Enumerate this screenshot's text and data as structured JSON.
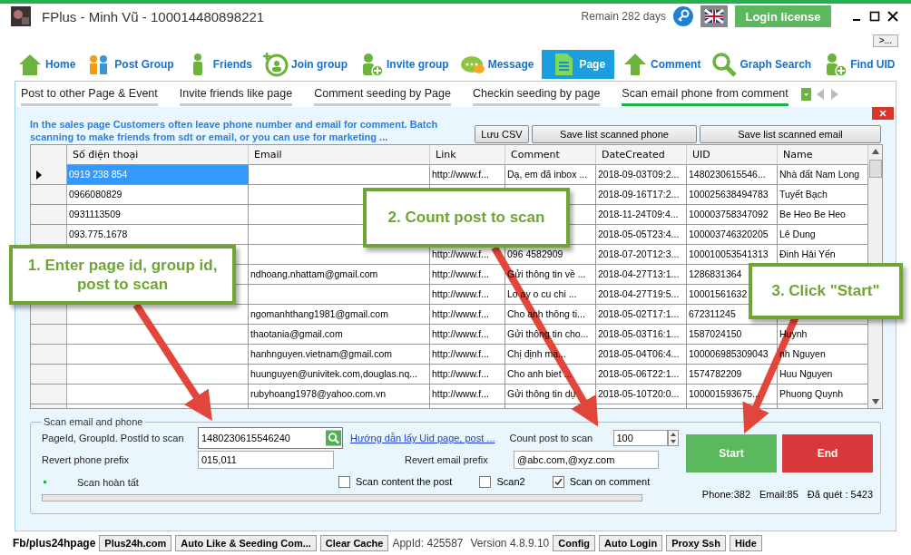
{
  "window": {
    "title": "FPlus - Minh Vũ - 100014480898221",
    "remain": "Remain 282 days",
    "login_button": "Login license",
    "overflow_button": ">..."
  },
  "toolbar": [
    {
      "label": "Home",
      "selected": false
    },
    {
      "label": "Post Group",
      "selected": false
    },
    {
      "label": "Friends",
      "selected": false
    },
    {
      "label": "Join group",
      "selected": false
    },
    {
      "label": "Invite group",
      "selected": false
    },
    {
      "label": "Message",
      "selected": false
    },
    {
      "label": "Page",
      "selected": true
    },
    {
      "label": "Comment",
      "selected": false
    },
    {
      "label": "Graph Search",
      "selected": false
    },
    {
      "label": "Find UID",
      "selected": false
    }
  ],
  "tabs": [
    {
      "label": "Post to other Page & Event",
      "selected": false
    },
    {
      "label": "Invite friends like page",
      "selected": false
    },
    {
      "label": "Comment seeding by Page",
      "selected": false
    },
    {
      "label": "Checkin seeding by page",
      "selected": false
    },
    {
      "label": "Scan email phone from comment",
      "selected": true
    }
  ],
  "panel": {
    "info": "In the sales page Customers often leave phone number and email for comment. Batch scanning to make friends from sdt or email, or you can use for marketing ...",
    "buttons": [
      "Lưu CSV",
      "Save list scanned phone",
      "Save list scanned email"
    ]
  },
  "table": {
    "columns": [
      "Số điện thoại",
      "Email",
      "Link",
      "Comment",
      "DateCreated",
      "UID",
      "Name"
    ],
    "rows": [
      {
        "selected": true,
        "cells": [
          "0919 238 854",
          null,
          "http://www.f...",
          "Dạ, em đã inbox ...",
          "2018-09-03T09:2...",
          "1480230615546...",
          "Nhà đất Nam Long"
        ]
      },
      {
        "selected": false,
        "cells": [
          "0966080829",
          null,
          null,
          null,
          "2018-09-16T17:2...",
          "100025638494783",
          "Tuyết Bạch"
        ]
      },
      {
        "selected": false,
        "cells": [
          "0931113509",
          null,
          null,
          null,
          "2018-11-24T09:4...",
          "100003758347092",
          "Be Heo Be Heo"
        ]
      },
      {
        "selected": false,
        "cells": [
          "093.775.1678",
          null,
          null,
          null,
          "2018-05-05T23:4...",
          "100003746320205",
          "Lê Dung"
        ]
      },
      {
        "selected": false,
        "cells": [
          null,
          null,
          "http://www.f...",
          "096 4582909",
          "2018-07-20T12:3...",
          "100010053541313",
          "Đinh Hải Yến"
        ]
      },
      {
        "selected": false,
        "cells": [
          null,
          "ndhoang.nhattam@gmail.com",
          "http://www.f...",
          "Gửi thông tin về ...",
          "2018-04-27T13:1...",
          "1286831364",
          null
        ]
      },
      {
        "selected": false,
        "cells": [
          null,
          null,
          "http://www.f...",
          "Lo ay o cu chi ...",
          "2018-04-27T19:5...",
          "10001561632",
          null
        ]
      },
      {
        "selected": false,
        "cells": [
          null,
          "ngomanhthang1981@gmail.com",
          "http://www.f...",
          "Cho anh thông ti...",
          "2018-05-02T17:1...",
          "672311245",
          null
        ]
      },
      {
        "selected": false,
        "cells": [
          null,
          "thaotania@gmail.com",
          "http://www.f...",
          "Gửi thông tin cho...",
          "2018-05-03T16:1...",
          "1587024150",
          "Huynh"
        ]
      },
      {
        "selected": false,
        "cells": [
          null,
          "hanhnguyen.vietnam@gmail.com",
          "http://www.f...",
          "Chị định ma...",
          "2018-05-04T06:4...",
          "100006985309043",
          "nh Nguyen"
        ]
      },
      {
        "selected": false,
        "cells": [
          null,
          "huunguyen@univitek.com,douglas.nq...",
          "http://www.f...",
          "Cho anh biet ...",
          "2018-05-06T22:1...",
          "1574782209",
          "Huu Nguyen"
        ]
      },
      {
        "selected": false,
        "cells": [
          null,
          "rubyhoang1978@yahoo.com.vn",
          "http://www.f...",
          "Gửi thông tin dụ",
          "2018-05-10T20:0...",
          "100001593675...",
          "Phuong Quynh"
        ]
      }
    ]
  },
  "scan_form": {
    "title": "Scan email and phone",
    "id_label": "PageId, GroupId. PostId to scan",
    "id_value": "1480230615546240",
    "help_link": "Hướng dẫn lấy Uid page, post ...",
    "count_label": "Count post to scan",
    "count_value": "100",
    "phone_prefix_label": "Revert phone prefix",
    "phone_prefix_value": "015,011",
    "email_prefix_label": "Revert email prefix",
    "email_prefix_value": "@abc.com,@xyz.com",
    "status": "Scan hoàn tất",
    "options": [
      {
        "label": "Scan content the post",
        "checked": false
      },
      {
        "label": "Scan2",
        "checked": false
      },
      {
        "label": "Scan on comment",
        "checked": true
      }
    ],
    "start_button": "Start",
    "end_button": "End",
    "stats": [
      "Phone:382",
      "Email:85",
      "Đã quét : 5423"
    ],
    "progress": {
      "level": 0
    }
  },
  "callouts": [
    "1. Enter page id, group id, post to scan",
    "2. Count post to scan",
    "3. Click \"Start\""
  ],
  "status_bar": {
    "page": "Fb/plus24hpage",
    "buttons_left": [
      "Plus24h.com",
      "Auto Like & Seeding Com...",
      "Clear Cache"
    ],
    "app_id": "AppId: 425587",
    "version": "Version 4.8.9.10",
    "buttons_right": [
      "Config",
      "Auto Login",
      "Proxy Ssh",
      "Hide"
    ]
  }
}
